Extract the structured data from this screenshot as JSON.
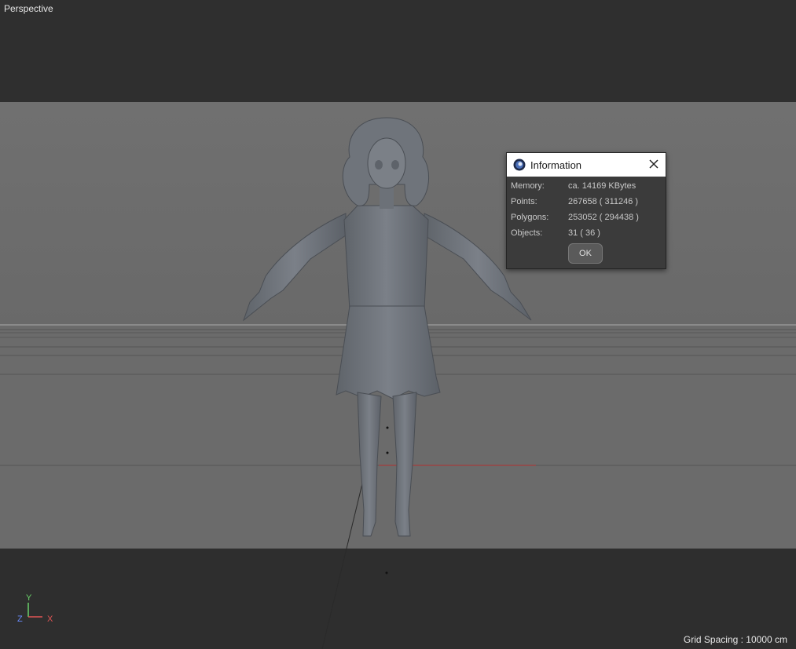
{
  "viewport": {
    "label": "Perspective",
    "grid_spacing": "Grid Spacing : 10000 cm",
    "axes": {
      "y": "Y",
      "z": "Z",
      "x": "X"
    }
  },
  "dialog": {
    "title": "Information",
    "rows": [
      {
        "key": "Memory:",
        "value": "ca. 14169 KBytes"
      },
      {
        "key": "Points:",
        "value": "267658 ( 311246 )"
      },
      {
        "key": "Polygons:",
        "value": "253052 ( 294438 )"
      },
      {
        "key": "Objects:",
        "value": "31 ( 36 )"
      }
    ],
    "ok_label": "OK"
  }
}
